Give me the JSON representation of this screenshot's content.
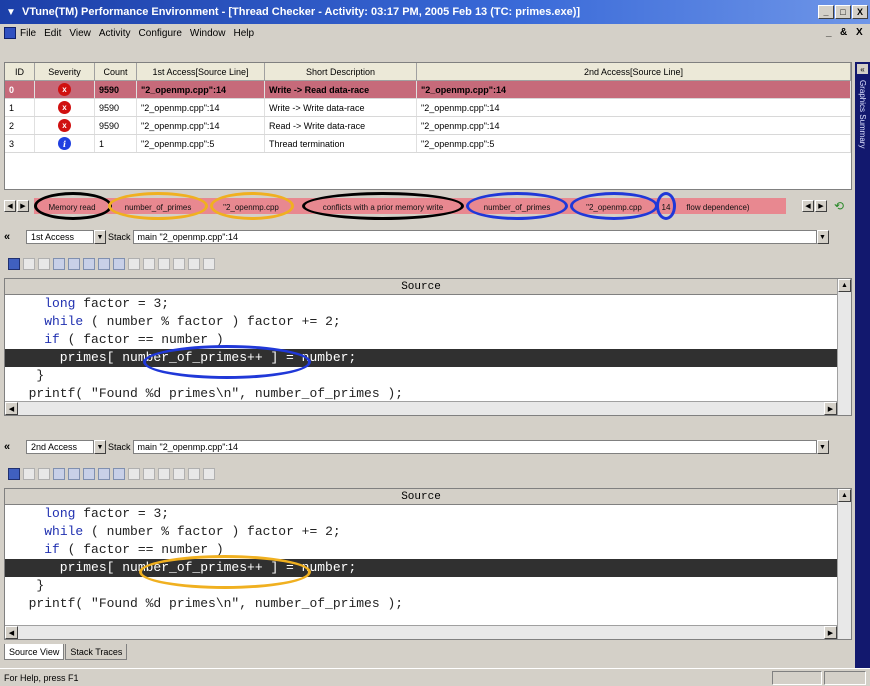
{
  "window": {
    "title": "VTune(TM) Performance Environment - [Thread Checker - Activity: 03:17 PM, 2005 Feb 13 (TC: primes.exe)]",
    "buttons": [
      "_",
      "□",
      "X"
    ]
  },
  "menu": {
    "items": [
      "File",
      "Edit",
      "View",
      "Activity",
      "Configure",
      "Window",
      "Help"
    ],
    "mdi_buttons": [
      "_",
      "&",
      "X"
    ]
  },
  "side_panel": {
    "label": "Graphics Summary",
    "collapse": "«"
  },
  "table": {
    "headers": [
      "ID",
      "Severity",
      "Count",
      "1st Access[Source Line]",
      "Short Description",
      "2nd Access[Source Line]"
    ],
    "rows": [
      {
        "id": "0",
        "severity": "error",
        "count": "9590",
        "first": "\"2_openmp.cpp\":14",
        "desc": "Write -> Read data-race",
        "second": "\"2_openmp.cpp\":14",
        "selected": true
      },
      {
        "id": "1",
        "severity": "error",
        "count": "9590",
        "first": "\"2_openmp.cpp\":14",
        "desc": "Write -> Write data-race",
        "second": "\"2_openmp.cpp\":14",
        "selected": false
      },
      {
        "id": "2",
        "severity": "error",
        "count": "9590",
        "first": "\"2_openmp.cpp\":14",
        "desc": "Read -> Write data-race",
        "second": "\"2_openmp.cpp\":14",
        "selected": false
      },
      {
        "id": "3",
        "severity": "info",
        "count": "1",
        "first": "\"2_openmp.cpp\":5",
        "desc": "Thread termination",
        "second": "\"2_openmp.cpp\":5",
        "selected": false
      }
    ],
    "severity_glyphs": {
      "error": "x",
      "info": "i"
    }
  },
  "description_strip": {
    "segments": [
      "Memory read",
      "number_of_primes",
      "\"2_openmp.cpp",
      "conflicts with a prior memory write",
      "number_of_primes",
      "\"2_openmp.cpp",
      "14",
      "flow dependence)"
    ]
  },
  "first_access": {
    "collapse": "«",
    "mode": "1st Access",
    "stack_label": "Stack",
    "stack_value": "main \"2_openmp.cpp\":14",
    "header": "Source"
  },
  "second_access": {
    "collapse": "«",
    "mode": "2nd Access",
    "stack_label": "Stack",
    "stack_value": "main \"2_openmp.cpp\":14",
    "header": "Source"
  },
  "code": {
    "line1_indent": "    ",
    "long_kw": "long",
    "line1_rest": " factor = 3;",
    "while_kw": "while",
    "line2_rest": " ( number % factor ) factor += 2;",
    "if_kw": "if",
    "line3_rest": " ( factor == number )",
    "line4": "      primes[ number_of_primes++ ] = number;",
    "line5": "   }",
    "line6": "  printf( \"Found %d primes\\n\", number_of_primes );"
  },
  "tabs": [
    "Source View",
    "Stack Traces"
  ],
  "status": {
    "text": "For Help, press F1"
  },
  "colors": {
    "title_bar": "#1c3fa8",
    "selected_row": "#c66a7a",
    "strip": "#e88890",
    "black_ring": "#000000",
    "gold_ring": "#f0b020",
    "blue_ring": "#2038d8"
  }
}
